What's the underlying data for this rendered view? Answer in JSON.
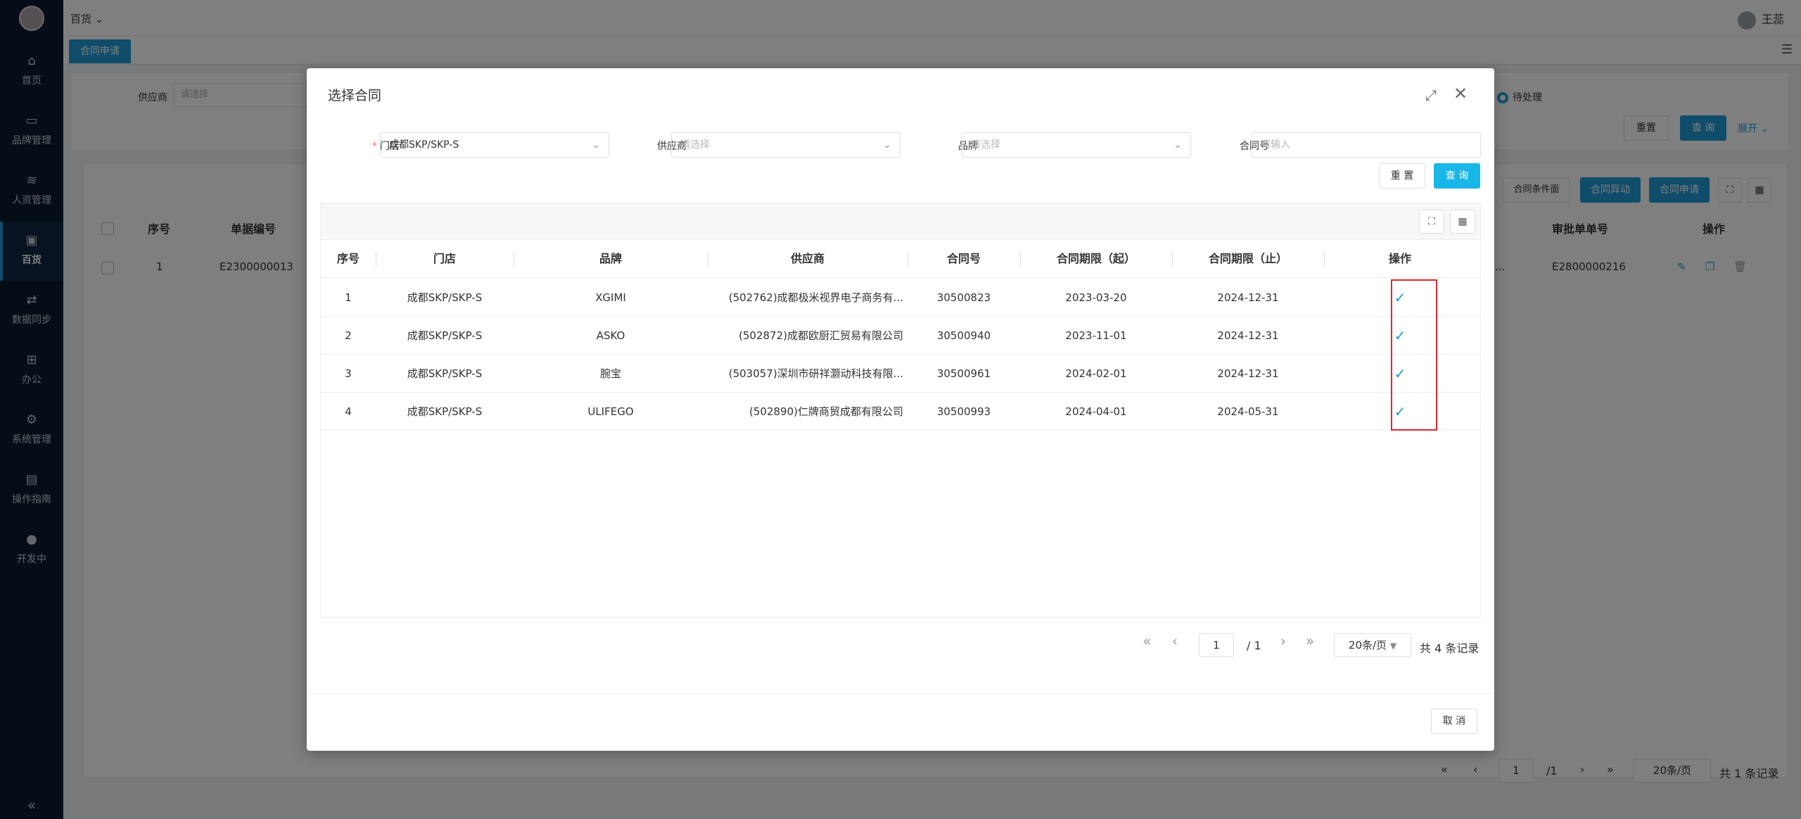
{
  "app": {
    "breadcrumb": "百货 ⌄",
    "user_name": "王蕊",
    "open_tab": "合同申请",
    "menu_icon": "menu-icon"
  },
  "sidebar": {
    "items": [
      {
        "label": "首页",
        "icon": "home-icon"
      },
      {
        "label": "品牌管理",
        "icon": "store-icon"
      },
      {
        "label": "人资管理",
        "icon": "layers-icon"
      },
      {
        "label": "百货",
        "icon": "bag-icon"
      },
      {
        "label": "数据同步",
        "icon": "sync-icon"
      },
      {
        "label": "办公",
        "icon": "grid-icon"
      },
      {
        "label": "系统管理",
        "icon": "gear-icon"
      },
      {
        "label": "操作指南",
        "icon": "book-icon"
      },
      {
        "label": "开发中",
        "icon": "bear-icon"
      }
    ],
    "active_index": 3
  },
  "background": {
    "filter_label": "供应商",
    "filter_placeholder": "请选择",
    "status_radio_label": "待处理",
    "reset_label": "重置",
    "query_label": "查 询",
    "expand_label": "展开 ⌄",
    "btn_conditions": "合同条件面",
    "btn_changes": "合同异动",
    "btn_apply": "合同申请",
    "columns": [
      "序号",
      "单据编号",
      "审批单单号",
      "操作"
    ],
    "row": {
      "index": "1",
      "doc_no": "E2300000013",
      "approval_no": "E2800000216",
      "truncated": "...."
    },
    "pager": {
      "page": "1",
      "total_pages": "/1",
      "page_size": "20条/页",
      "total": "共 1 条记录"
    }
  },
  "modal": {
    "title": "选择合同",
    "filters": {
      "store_label": "门店",
      "store_value": "成都SKP/SKP-S",
      "supplier_label": "供应商",
      "supplier_placeholder": "请选择",
      "brand_label": "品牌",
      "brand_placeholder": "请选择",
      "contract_label": "合同号",
      "contract_placeholder": "请输入"
    },
    "reset_label": "重 置",
    "query_label": "查 询",
    "columns": [
      "序号",
      "门店",
      "品牌",
      "供应商",
      "合同号",
      "合同期限（起）",
      "合同期限（止）",
      "操作"
    ],
    "rows": [
      {
        "index": "1",
        "store": "成都SKP/SKP-S",
        "brand": "XGIMI",
        "supplier": "(502762)成都极米视界电子商务有...",
        "contract": "30500823",
        "start": "2023-03-20",
        "end": "2024-12-31"
      },
      {
        "index": "2",
        "store": "成都SKP/SKP-S",
        "brand": "ASKO",
        "supplier": "(502872)成都欧厨汇贸易有限公司",
        "contract": "30500940",
        "start": "2023-11-01",
        "end": "2024-12-31"
      },
      {
        "index": "3",
        "store": "成都SKP/SKP-S",
        "brand": "腕宝",
        "supplier": "(503057)深圳市研祥灏动科技有限...",
        "contract": "30500961",
        "start": "2024-02-01",
        "end": "2024-12-31"
      },
      {
        "index": "4",
        "store": "成都SKP/SKP-S",
        "brand": "ULIFEGO",
        "supplier": "(502890)仁牌商贸成都有限公司",
        "contract": "30500993",
        "start": "2024-04-01",
        "end": "2024-05-31"
      }
    ],
    "pager": {
      "page": "1",
      "total_pages": "/ 1",
      "page_size": "20条/页",
      "total": "共 4 条记录"
    },
    "cancel_label": "取 消",
    "accent_color": "#1e9bd7",
    "highlight_color": "#e1252e"
  }
}
